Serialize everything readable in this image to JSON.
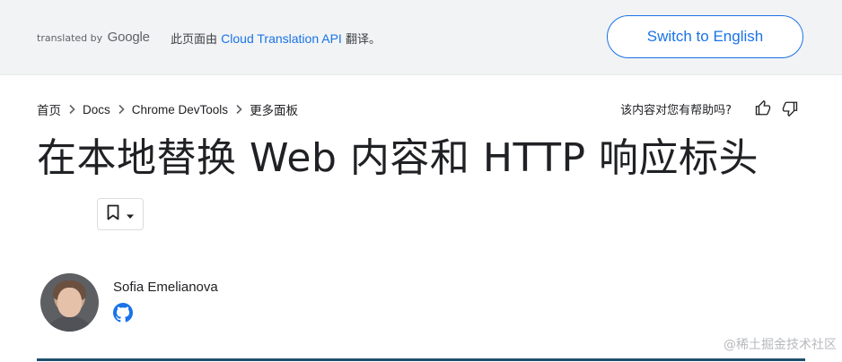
{
  "translate_bar": {
    "translated_by": "translated by",
    "google": "Google",
    "message_prefix": "此页面由",
    "service_link": "Cloud Translation API",
    "message_suffix": "翻译。",
    "switch_button": "Switch to English"
  },
  "breadcrumb": {
    "items": [
      "首页",
      "Docs",
      "Chrome DevTools",
      "更多面板"
    ]
  },
  "feedback": {
    "question": "该内容对您有帮助吗?"
  },
  "page": {
    "title": "在本地替换 Web 内容和 HTTP 响应标头"
  },
  "author": {
    "name": "Sofia Emelianova"
  },
  "watermark": "@稀土掘金技术社区",
  "colors": {
    "accent": "#1a73e8",
    "bar_bg": "#f1f3f4",
    "divider": "#1f4e6e"
  },
  "icons": {
    "breadcrumb_separator": "chevron-right-icon",
    "thumb_up": "thumb-up-icon",
    "thumb_down": "thumb-down-icon",
    "bookmark": "bookmark-icon",
    "dropdown": "arrow-drop-down-icon",
    "github": "github-icon"
  }
}
